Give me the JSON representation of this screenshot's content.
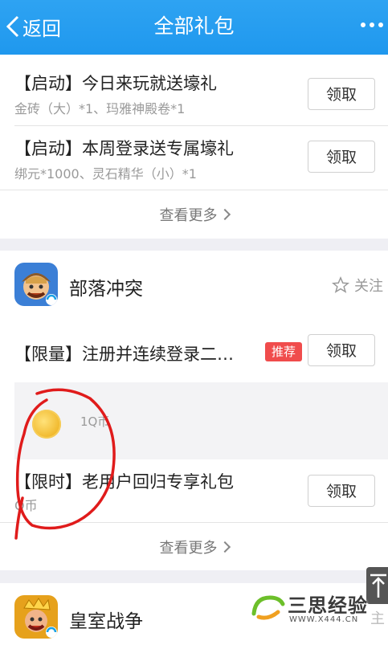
{
  "header": {
    "back_label": "返回",
    "title": "全部礼包"
  },
  "section1": {
    "items": [
      {
        "title": "【启动】今日来玩就送壕礼",
        "sub": "金砖（大）*1、玛雅神殿卷*1",
        "button": "领取"
      },
      {
        "title": "【启动】本周登录送专属壕礼",
        "sub": "绑元*1000、灵石精华（小）*1",
        "button": "领取"
      }
    ],
    "see_more": "查看更多"
  },
  "section2": {
    "game_name": "部落冲突",
    "follow_label": "关注",
    "items": [
      {
        "title": "【限量】注册并连续登录二…",
        "badge": "推荐",
        "button": "领取"
      },
      {
        "title": "【限时】老用户回归专享礼包",
        "sub": "Q币",
        "button": "领取"
      }
    ],
    "reward_amount": "1Q币",
    "see_more": "查看更多"
  },
  "section3": {
    "game_name": "皇室战争"
  },
  "watermark": {
    "brand": "三思经验",
    "url": "WWW.X444.CN"
  },
  "overlay_text": {
    "follow_partial": "主"
  }
}
